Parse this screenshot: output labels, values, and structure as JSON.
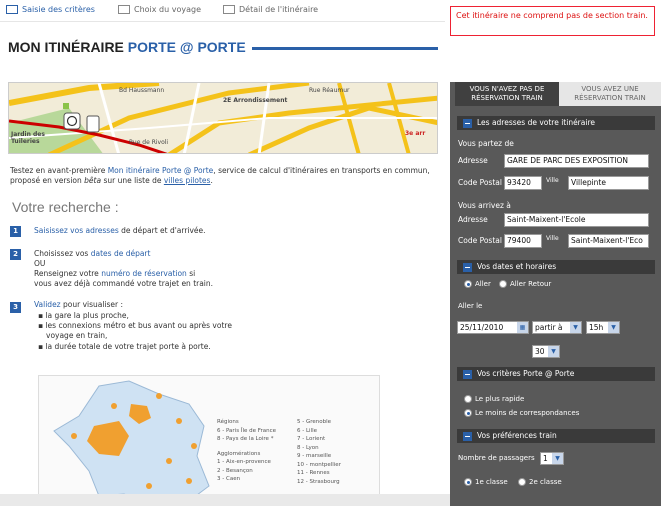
{
  "steps": [
    "Saisie des critères",
    "Choix du voyage",
    "Détail de l'itinéraire"
  ],
  "warning": "Cet itinéraire ne comprend pas de section train.",
  "title": {
    "prefix": "MON ITINÉRAIRE ",
    "accent": "PORTE @ PORTE"
  },
  "map": {
    "labels": [
      "2E Arrondissement",
      "Jardin des Tuileries",
      "3e arr",
      "Rue de Rivoli",
      "Rue Réaumur",
      "Bd Haussmann"
    ],
    "colors": {
      "bg": "#f2ecd8",
      "road": "#f4c21a",
      "route": "#cc0000",
      "park": "#b8d89a"
    }
  },
  "intro": {
    "t1": "Testez en avant-première ",
    "link1": "Mon itinéraire Porte @ Porte",
    "t2": ", service de calcul d'itinéraires en transports en commun, proposé en version ",
    "t3": "bêta",
    "t4": " sur une liste de ",
    "link2": "villes pilotes",
    "t5": "."
  },
  "recherche": "Votre recherche :",
  "instr": {
    "s1": {
      "num": "1",
      "a": "Saisissez vos adresses",
      "b": " de départ et d'arrivée."
    },
    "s2": {
      "num": "2",
      "a": "Choisissez vos ",
      "b": "dates de départ",
      "c": "OU",
      "d": "Renseignez votre ",
      "e": "numéro de réservation",
      "f": " si",
      "g": "vous avez déjà commandé votre trajet en train."
    },
    "s3": {
      "num": "3",
      "a": "Validez",
      "b": " pour visualiser :",
      "bullets": [
        "la gare la plus proche,",
        "les connexions métro et bus avant ou après votre",
        "voyage en train,",
        "la durée totale de votre trajet porte à porte."
      ]
    }
  },
  "france_legend": {
    "col1": [
      "Régions",
      "6 - Paris Île de France",
      "8 - Pays de la Loire *",
      "",
      "Agglomérations",
      "1 - Aix-en-provence",
      "2 - Besançon",
      "3 - Caen"
    ],
    "col2": [
      "5 - Grenoble",
      "6 - Lille",
      "7 - Lorient",
      "8 - Lyon",
      "9 - marseille",
      "10 - montpellier",
      "11 - Rennes",
      "12 - Strasbourg"
    ]
  },
  "panel": {
    "tab_active": [
      "VOUS N'AVEZ PAS DE",
      "RÉSERVATION TRAIN"
    ],
    "tab_inactive": [
      "VOUS AVEZ UNE",
      "RÉSERVATION TRAIN"
    ],
    "sec_addresses": "Les adresses de votre itinéraire",
    "depart_title": "Vous partez de",
    "adresse_label": "Adresse",
    "cp_label": "Code Postal",
    "ville_label": "Ville",
    "depart_addr": "GARE DE PARC DES EXPOSITION",
    "depart_cp": "93420",
    "depart_ville": "Villepinte",
    "arrivee_title": "Vous arrivez à",
    "arrivee_addr": "Saint-Maixent-l'Ecole",
    "arrivee_cp": "79400",
    "arrivee_ville": "Saint-Maixent-l'Eco",
    "sec_dates": "Vos dates et horaires",
    "opt_aller": "Aller",
    "opt_aller_retour": "Aller Retour",
    "aller_label": "Aller le",
    "date": "25/11/2010",
    "partir": "partir à",
    "hour": "15h",
    "minutes": "30",
    "sec_criteres": "Vos critères Porte @ Porte",
    "crit1": "Le plus rapide",
    "crit2": "Le moins de correspondances",
    "sec_prefs": "Vos préférences train",
    "passagers_label": "Nombre de passagers",
    "passagers": "1",
    "classe1": "1e classe",
    "classe2": "2e classe"
  }
}
